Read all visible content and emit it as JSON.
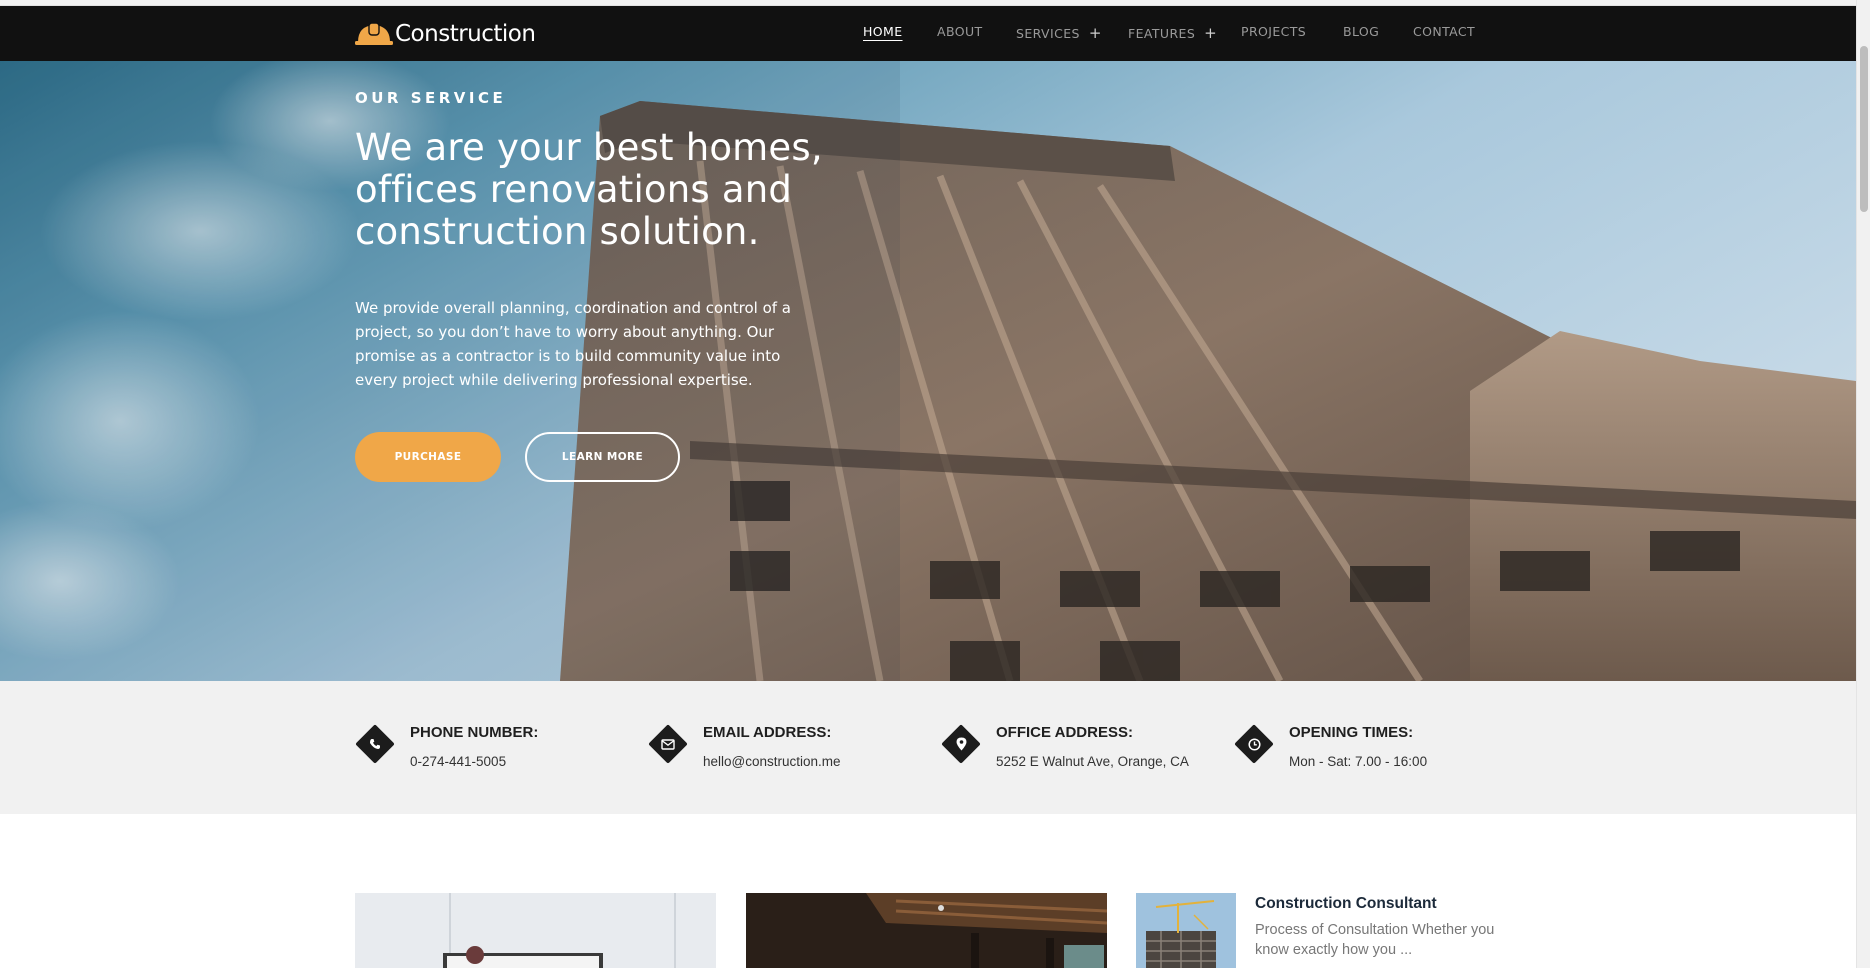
{
  "brand": {
    "name": "Construction",
    "icon": "hard-hat-icon",
    "accent": "#f0a748"
  },
  "nav": {
    "items": [
      {
        "label": "HOME",
        "active": true
      },
      {
        "label": "ABOUT"
      },
      {
        "label": "SERVICES",
        "has_submenu": true,
        "submenu_marker": "+"
      },
      {
        "label": "FEATURES",
        "has_submenu": true,
        "submenu_marker": "+"
      },
      {
        "label": "PROJECTS"
      },
      {
        "label": "BLOG"
      },
      {
        "label": "CONTACT"
      }
    ]
  },
  "hero": {
    "kicker": "OUR SERVICE",
    "title": "We are your best homes, offices renovations and construction solution.",
    "description": "We provide overall planning, coordination and control of a project, so you don’t have to worry about anything. Our promise as a contractor is to build community value into every project while delivering professional expertise.",
    "primary_button": "PURCHASE",
    "secondary_button": "LEARN MORE"
  },
  "info": [
    {
      "icon": "phone-icon",
      "title": "PHONE NUMBER:",
      "value": "0-274-441-5005"
    },
    {
      "icon": "envelope-icon",
      "title": "EMAIL ADDRESS:",
      "value": "hello@construction.me"
    },
    {
      "icon": "map-pin-icon",
      "title": "OFFICE ADDRESS:",
      "value": "5252 E Walnut Ave, Orange, CA"
    },
    {
      "icon": "clock-icon",
      "title": "OPENING TIMES:",
      "value": "Mon - Sat: 7.00 - 16:00"
    }
  ],
  "cards": {
    "featured": {
      "title": "Construction Consultant",
      "excerpt": "Process of Consultation Whether you know exactly how you ..."
    }
  },
  "colors": {
    "nav_bg": "#111111",
    "info_band_bg": "#f1f1f1",
    "button_primary": "#f0a748"
  }
}
